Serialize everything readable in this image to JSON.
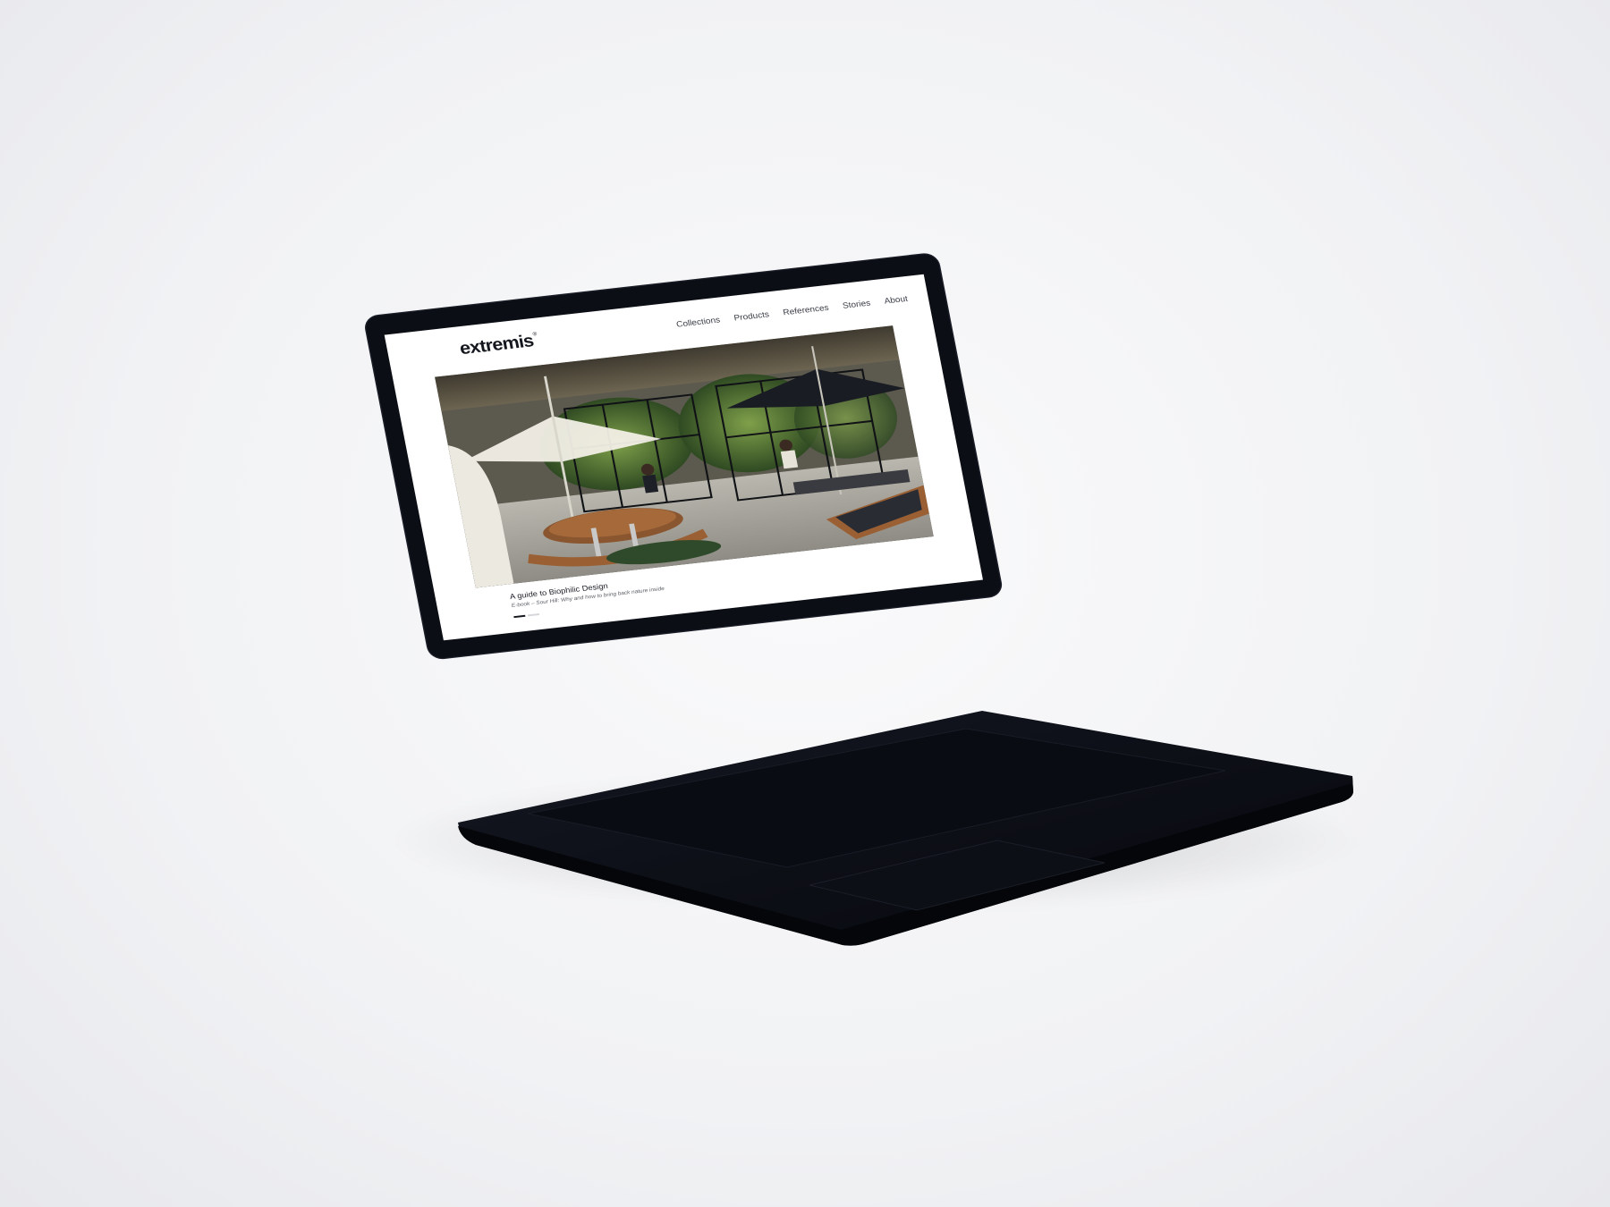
{
  "site": {
    "logo": "extremis",
    "logo_mark": "®",
    "nav": [
      {
        "label": "Collections"
      },
      {
        "label": "Products"
      },
      {
        "label": "References"
      },
      {
        "label": "Stories"
      },
      {
        "label": "About"
      }
    ]
  },
  "hero": {
    "title": "A guide to Biophilic Design",
    "subtitle": "E-book – Sour Hill: Why and how to bring back nature inside"
  },
  "colors": {
    "laptop": "#0c0e16",
    "screen_bg": "#ffffff",
    "text_dark": "#15171f"
  }
}
